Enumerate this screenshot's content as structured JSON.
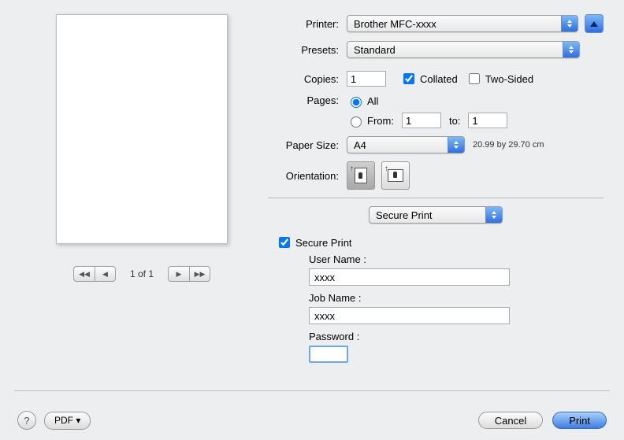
{
  "labels": {
    "printer": "Printer:",
    "presets": "Presets:",
    "copies": "Copies:",
    "collated": "Collated",
    "twoSided": "Two-Sided",
    "pages": "Pages:",
    "all": "All",
    "from": "From:",
    "to": "to:",
    "paperSize": "Paper Size:",
    "orientation": "Orientation:",
    "securePrintChk": "Secure Print",
    "userName": "User Name :",
    "jobName": "Job Name :",
    "password": "Password :",
    "pdf": "PDF ▾",
    "cancel": "Cancel",
    "print": "Print",
    "help": "?"
  },
  "values": {
    "printer": "Brother MFC-xxxx",
    "preset": "Standard",
    "copies": "1",
    "collated": true,
    "twoSided": false,
    "pagesAll": true,
    "fromPage": "1",
    "toPage": "1",
    "paperSize": "A4",
    "paperDims": "20.99 by 29.70 cm",
    "panel": "Secure Print",
    "securePrintOn": true,
    "userName": "xxxx",
    "jobName": "xxxx",
    "password": ""
  },
  "preview": {
    "counter": "1 of 1"
  }
}
